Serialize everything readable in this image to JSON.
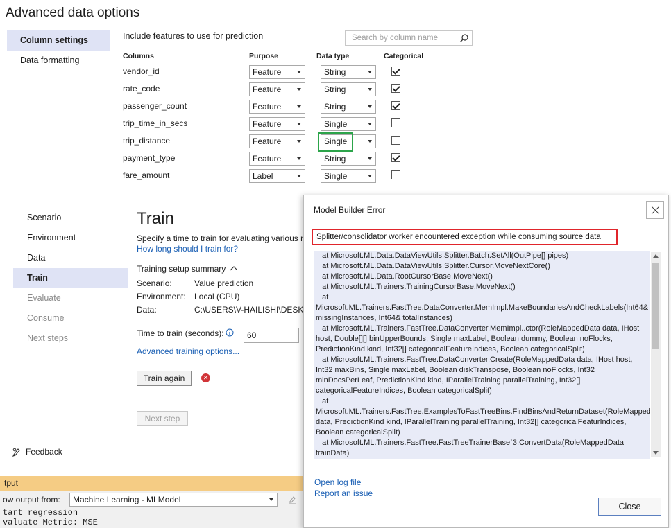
{
  "advanced": {
    "title": "Advanced data options",
    "sidebar": [
      {
        "label": "Column settings",
        "active": true
      },
      {
        "label": "Data formatting",
        "active": false
      }
    ],
    "include_label": "Include features to use for prediction",
    "search_placeholder": "Search by column name",
    "headers": {
      "columns": "Columns",
      "purpose": "Purpose",
      "datatype": "Data type",
      "categorical": "Categorical"
    },
    "rows": [
      {
        "name": "vendor_id",
        "purpose": "Feature",
        "type": "String",
        "categorical": true
      },
      {
        "name": "rate_code",
        "purpose": "Feature",
        "type": "String",
        "categorical": true
      },
      {
        "name": "passenger_count",
        "purpose": "Feature",
        "type": "String",
        "categorical": true
      },
      {
        "name": "trip_time_in_secs",
        "purpose": "Feature",
        "type": "Single",
        "categorical": false
      },
      {
        "name": "trip_distance",
        "purpose": "Feature",
        "type": "Single",
        "categorical": false
      },
      {
        "name": "payment_type",
        "purpose": "Feature",
        "type": "String",
        "categorical": true
      },
      {
        "name": "fare_amount",
        "purpose": "Label",
        "type": "Single",
        "categorical": false
      }
    ]
  },
  "nav": [
    {
      "label": "Scenario",
      "state": "normal"
    },
    {
      "label": "Environment",
      "state": "normal"
    },
    {
      "label": "Data",
      "state": "normal"
    },
    {
      "label": "Train",
      "state": "active"
    },
    {
      "label": "Evaluate",
      "state": "disabled"
    },
    {
      "label": "Consume",
      "state": "disabled"
    },
    {
      "label": "Next steps",
      "state": "disabled"
    }
  ],
  "feedback": "Feedback",
  "train": {
    "heading": "Train",
    "description": "Specify a time to train for evaluating various r",
    "how_long_link": "How long should I train for?",
    "summary_title": "Training setup summary",
    "summary": {
      "scenario_key": "Scenario:",
      "scenario_val": "Value prediction",
      "environment_key": "Environment:",
      "environment_val": "Local (CPU)",
      "data_key": "Data:",
      "data_val": "C:\\USERS\\V-HAILISHI\\DESKTO"
    },
    "time_label": "Time to train (seconds):",
    "time_value": "60",
    "advanced_link": "Advanced training options...",
    "train_again": "Train again",
    "next_step": "Next step"
  },
  "output": {
    "title": "tput",
    "from_label": "ow output from:",
    "source": "Machine Learning - MLModel",
    "lines": [
      "tart regression",
      "valuate Metric: MSE"
    ]
  },
  "modal": {
    "title": "Model Builder Error",
    "error": "Splitter/consolidator worker encountered exception while consuming source data",
    "stack": "   at Microsoft.ML.Data.DataViewUtils.Splitter.Batch.SetAll(OutPipe[] pipes)\n   at Microsoft.ML.Data.DataViewUtils.Splitter.Cursor.MoveNextCore()\n   at Microsoft.ML.Data.RootCursorBase.MoveNext()\n   at Microsoft.ML.Trainers.TrainingCursorBase.MoveNext()\n   at\nMicrosoft.ML.Trainers.FastTree.DataConverter.MemImpl.MakeBoundariesAndCheckLabels(Int64& missingInstances, Int64& totalInstances)\n   at Microsoft.ML.Trainers.FastTree.DataConverter.MemImpl..ctor(RoleMappedData data, IHost host, Double[][] binUpperBounds, Single maxLabel, Boolean dummy, Boolean noFlocks, PredictionKind kind, Int32[] categoricalFeatureIndices, Boolean categoricalSplit)\n   at Microsoft.ML.Trainers.FastTree.DataConverter.Create(RoleMappedData data, IHost host, Int32 maxBins, Single maxLabel, Boolean diskTranspose, Boolean noFlocks, Int32 minDocsPerLeaf, PredictionKind kind, IParallelTraining parallelTraining, Int32[] categoricalFeatureIndices, Boolean categoricalSplit)\n   at Microsoft.ML.Trainers.FastTree.ExamplesToFastTreeBins.FindBinsAndReturnDataset(RoleMappedData data, PredictionKind kind, IParallelTraining parallelTraining, Int32[] categoricalFeaturIndices, Boolean categoricalSplit)\n   at Microsoft.ML.Trainers.FastTree.FastTreeTrainerBase`3.ConvertData(RoleMappedData trainData)\n   at Microsoft.ML.Trainers.FastTree.FastForestRegressionTrainer.TrainModelCore",
    "open_log": "Open log file",
    "report_issue": "Report an issue",
    "close": "Close"
  }
}
